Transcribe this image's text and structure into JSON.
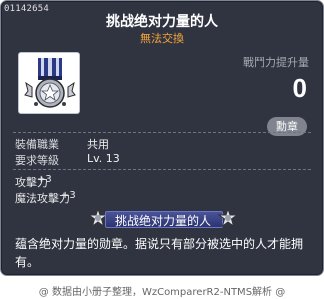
{
  "tooltip": {
    "item_id": "01142654",
    "item_name": "挑战绝对力量的人",
    "trade_status": "無法交換",
    "power_increase_label": "戰鬥力提升量",
    "power_increase_value": "0",
    "category_badge": "勳章",
    "requirements": [
      {
        "label": "裝備職業",
        "value": "共用"
      },
      {
        "label": "要求等級",
        "value": "Lv. 13"
      }
    ],
    "stats": [
      {
        "label": "攻擊力",
        "value": "+3"
      },
      {
        "label": "魔法攻擊力",
        "value": "+3"
      }
    ],
    "title_banner": "挑战绝对力量的人",
    "description": "蕴含绝对力量的勋章。据说只有部分被选中的人才能拥有。"
  },
  "footer": {
    "credit": "@ 数据由小册子整理，WzComparerR2-NTMS解析 @"
  },
  "colors": {
    "panel_bg": "#303441",
    "untradeable": "#f6a53a",
    "banner": "#3a4380"
  },
  "icons": [
    "medal-icon",
    "ornament-left-icon",
    "ornament-right-icon"
  ]
}
